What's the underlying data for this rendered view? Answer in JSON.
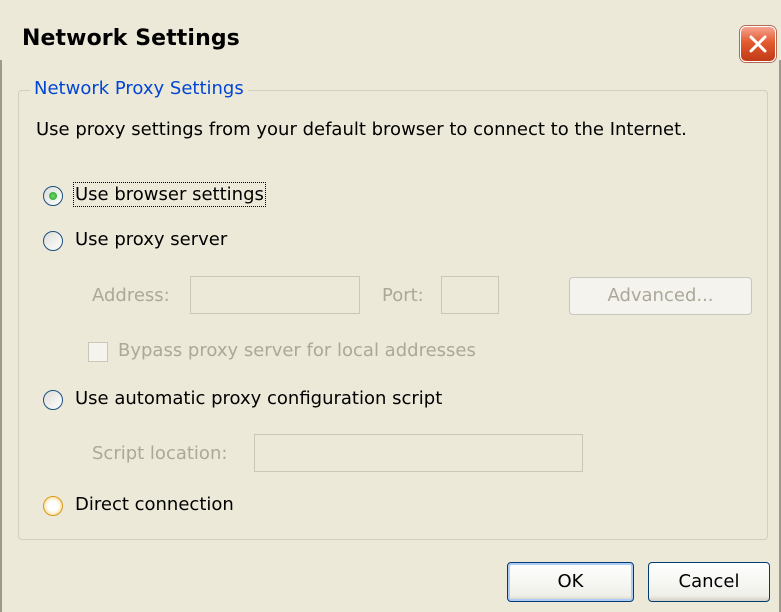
{
  "window": {
    "title": "Network Settings"
  },
  "group": {
    "legend": "Network Proxy Settings"
  },
  "description": "Use proxy settings from your default browser to connect to the Internet.",
  "options": {
    "browser": "Use browser settings",
    "proxy": "Use proxy server",
    "auto": "Use automatic proxy configuration script",
    "direct": "Direct connection"
  },
  "selected_option": "browser",
  "proxy_fields": {
    "address_label": "Address:",
    "address_value": "",
    "port_label": "Port:",
    "port_value": "",
    "advanced_label": "Advanced...",
    "bypass_label": "Bypass proxy server for local addresses",
    "bypass_checked": false
  },
  "script_fields": {
    "location_label": "Script location:",
    "location_value": ""
  },
  "buttons": {
    "ok": "OK",
    "cancel": "Cancel"
  },
  "colors": {
    "accent": "#0046d5",
    "disabled_text": "#aca899",
    "close_button": "#e25a2e",
    "dialog_bg": "#ece9d8"
  }
}
